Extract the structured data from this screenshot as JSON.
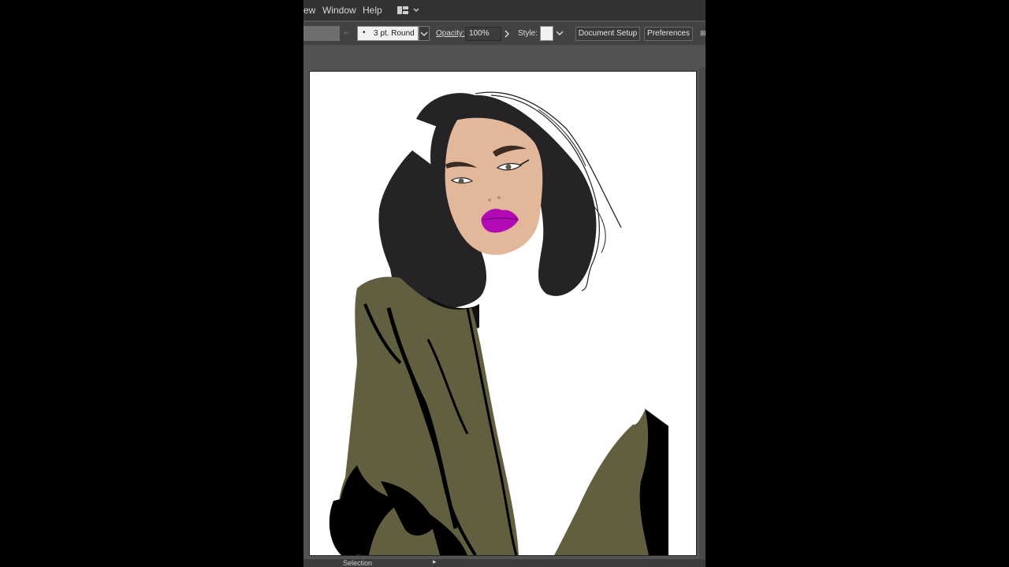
{
  "menubar": {
    "items": [
      "ew",
      "Window",
      "Help"
    ],
    "workspace_icon": "workspace-layout-icon"
  },
  "controlbar": {
    "brush_value": "3 pt. Round",
    "opacity_label": "Opacity:",
    "opacity_value": "100%",
    "style_label": "Style:",
    "document_setup_label": "Document Setup",
    "preferences_label": "Preferences"
  },
  "statusbar": {
    "tool_name": "Selection"
  },
  "colors": {
    "hair": "#252326",
    "skin": "#e2b79a",
    "lips": "#b20ab4",
    "coat": "#625f41",
    "shadow": "#000000"
  }
}
